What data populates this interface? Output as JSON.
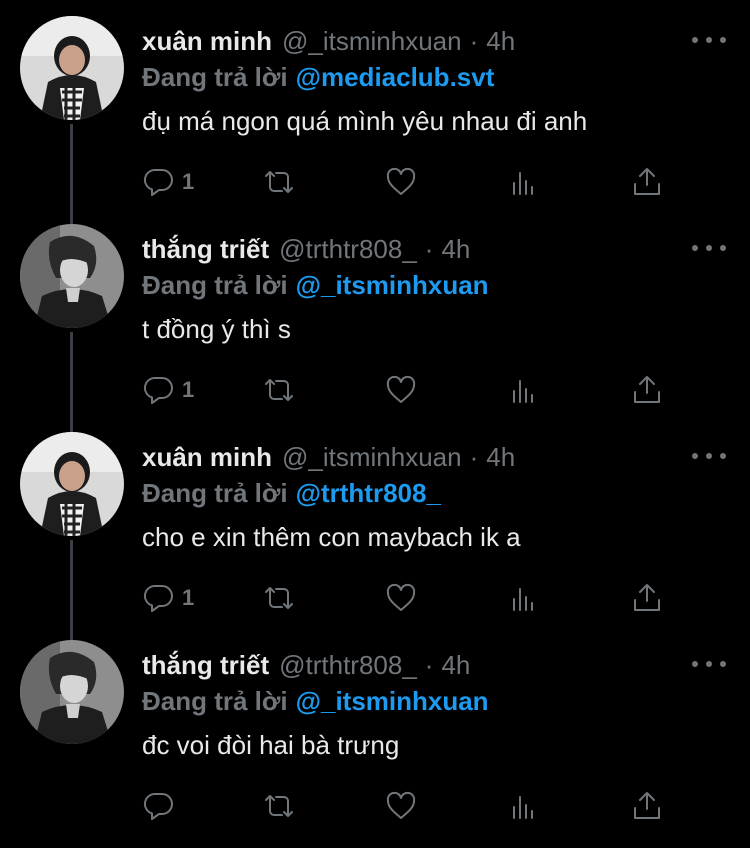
{
  "theme": {
    "background": "#000000",
    "text": "#e7e9ea",
    "muted": "#71767b",
    "accent": "#1d9bf0",
    "thread_line": "#3b3f43"
  },
  "tweets": [
    {
      "display_name": "xuân minh",
      "handle": "@_itsminhxuan",
      "separator": "·",
      "time": "4h",
      "reply_prefix": "Đang trả lời",
      "reply_to": "@mediaclub.svt",
      "text": "đụ má ngon quá mình yêu nhau đi anh",
      "reply_count": "1",
      "avatar": "avatar-xuan-minh",
      "icons": [
        "reply-icon",
        "retweet-icon",
        "like-icon",
        "views-icon",
        "share-icon",
        "more-icon"
      ]
    },
    {
      "display_name": "thắng triết",
      "handle": "@trthtr808_",
      "separator": "·",
      "time": "4h",
      "reply_prefix": "Đang trả lời",
      "reply_to": "@_itsminhxuan",
      "text": "t đồng ý thì s",
      "reply_count": "1",
      "avatar": "avatar-thang-triet",
      "icons": [
        "reply-icon",
        "retweet-icon",
        "like-icon",
        "views-icon",
        "share-icon",
        "more-icon"
      ]
    },
    {
      "display_name": "xuân minh",
      "handle": "@_itsminhxuan",
      "separator": "·",
      "time": "4h",
      "reply_prefix": "Đang trả lời",
      "reply_to": "@trthtr808_",
      "text": "cho e xin thêm con maybach ik a",
      "reply_count": "1",
      "avatar": "avatar-xuan-minh",
      "icons": [
        "reply-icon",
        "retweet-icon",
        "like-icon",
        "views-icon",
        "share-icon",
        "more-icon"
      ]
    },
    {
      "display_name": "thắng triết",
      "handle": "@trthtr808_",
      "separator": "·",
      "time": "4h",
      "reply_prefix": "Đang trả lời",
      "reply_to": "@_itsminhxuan",
      "text": "đc voi đòi hai bà trưng",
      "reply_count": "",
      "avatar": "avatar-thang-triet",
      "icons": [
        "reply-icon",
        "retweet-icon",
        "like-icon",
        "views-icon",
        "share-icon",
        "more-icon"
      ]
    }
  ]
}
